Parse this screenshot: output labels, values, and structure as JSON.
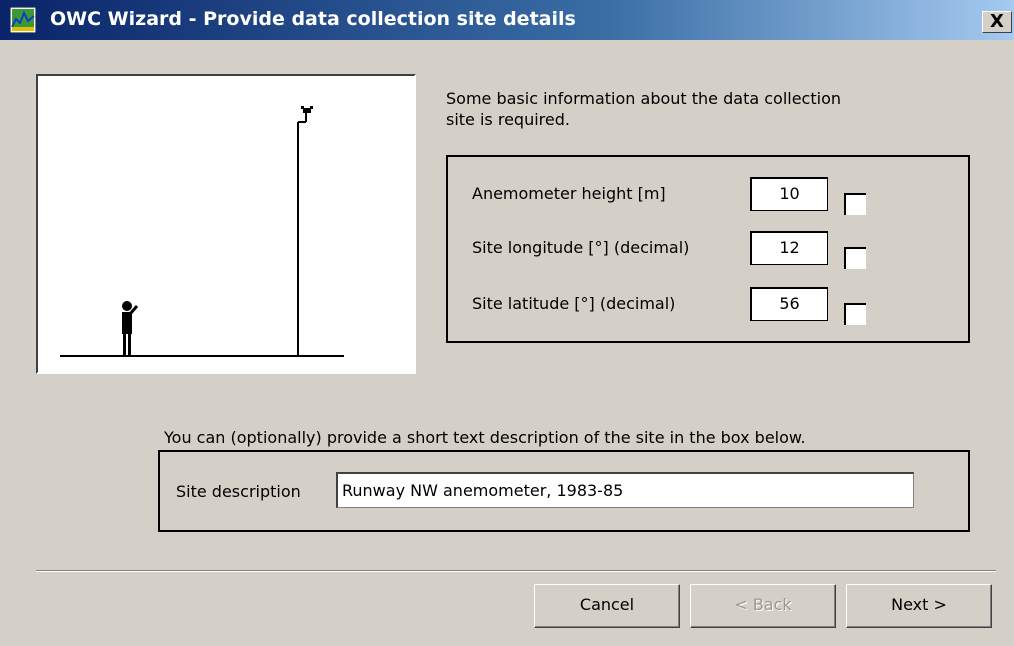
{
  "window": {
    "title": "OWC Wizard - Provide data collection site details",
    "close_label": "X",
    "title_gradient": [
      "#0a246a",
      "#a6caf0"
    ]
  },
  "intro_text": "Some basic information about the data collection site is required.",
  "parameters": [
    {
      "label": "Anemometer height [m]",
      "value": "10",
      "checked": false
    },
    {
      "label": "Site longitude [°] (decimal)",
      "value": "12",
      "checked": false
    },
    {
      "label": "Site latitude [°] (decimal)",
      "value": "56",
      "checked": false
    }
  ],
  "description": {
    "hint": "You can (optionally) provide a short text description of the site in the box below.",
    "label": "Site description",
    "value": "Runway NW anemometer, 1983-85"
  },
  "buttons": {
    "cancel": "Cancel",
    "back": "< Back",
    "next": "Next >",
    "back_enabled": false
  },
  "icons": {
    "app": "owc-wizard-icon",
    "illustration": "person-and-anemometer-mast"
  }
}
